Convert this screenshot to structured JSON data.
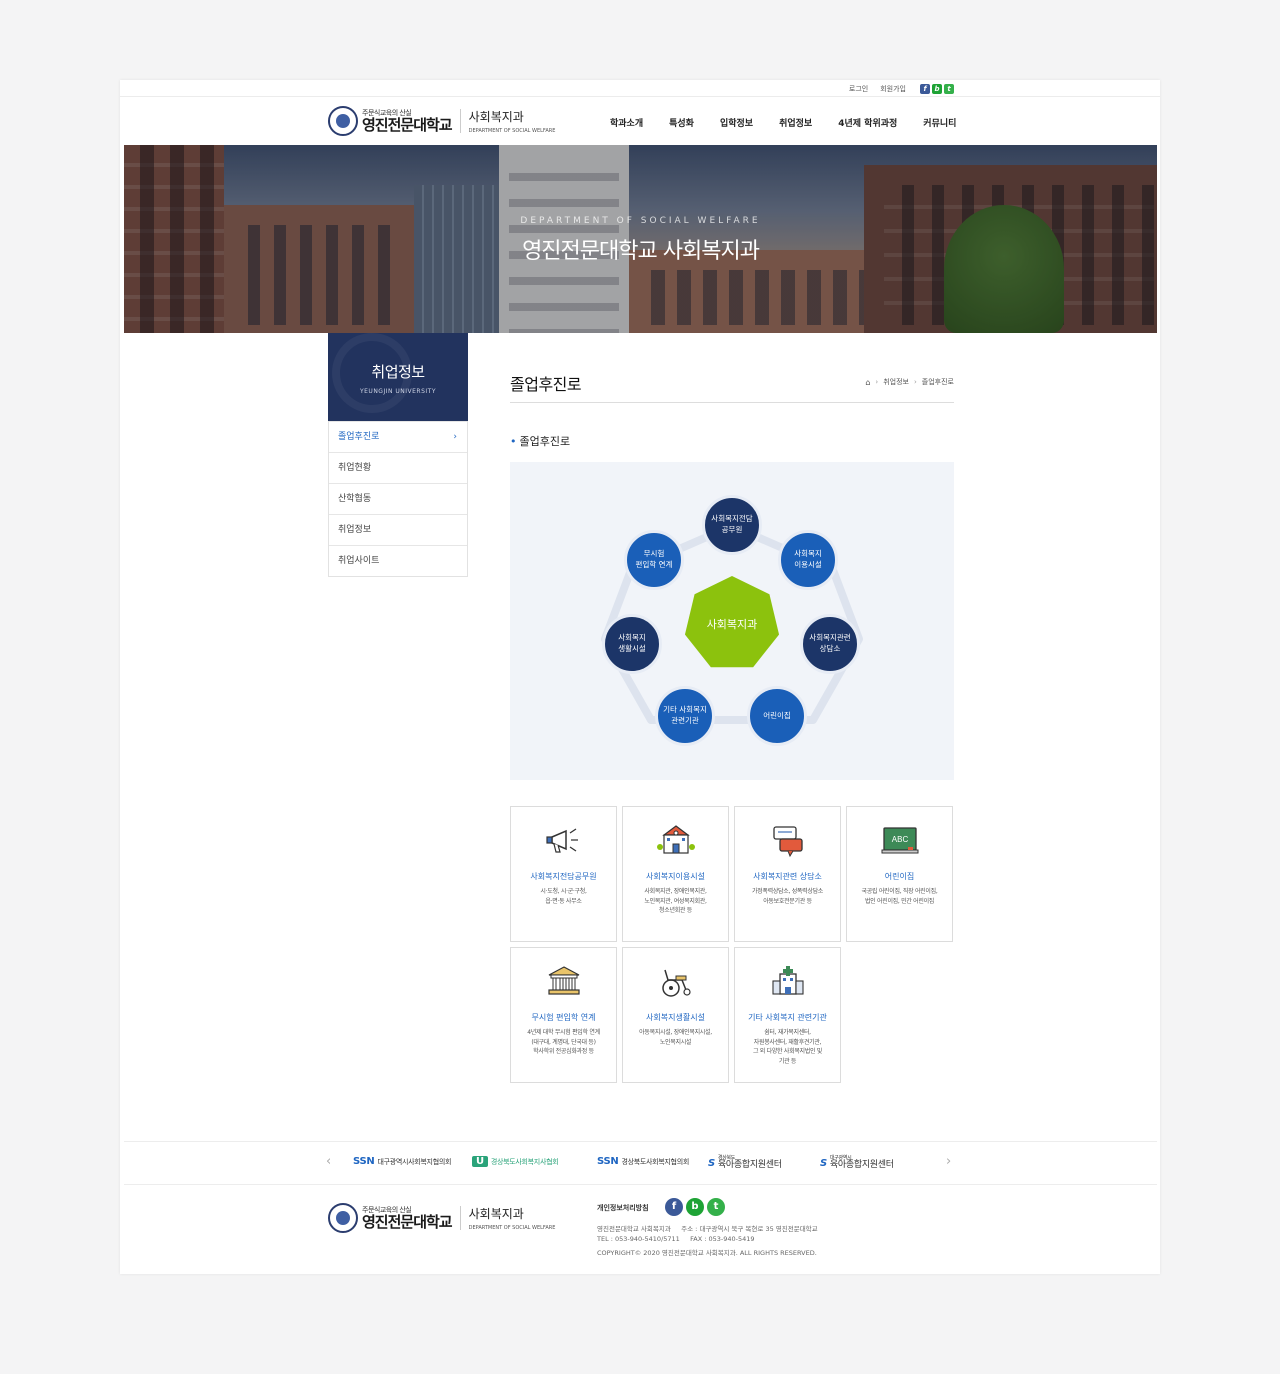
{
  "util": {
    "login": "로그인",
    "join": "회원가입",
    "sns": [
      "f",
      "b",
      "t"
    ]
  },
  "logo": {
    "slogan": "주문식교육의 산실",
    "school": "영진전문대학교",
    "dept_ko": "사회복지과",
    "dept_en": "DEPARTMENT OF SOCIAL WELFARE"
  },
  "gnb": [
    "학과소개",
    "특성화",
    "입학정보",
    "취업정보",
    "4년제 학위과정",
    "커뮤니티"
  ],
  "hero": {
    "en": "DEPARTMENT OF SOCIAL WELFARE",
    "ko": "영진전문대학교 사회복지과"
  },
  "lnb": {
    "title": "취업정보",
    "subtitle": "YEUNGJIN UNIVERSITY",
    "items": [
      "졸업후진로",
      "취업현황",
      "산학협동",
      "취업정보",
      "취업사이트"
    ]
  },
  "content": {
    "title": "졸업후진로",
    "breadcrumb": [
      "취업정보",
      "졸업후진로"
    ],
    "subtitle": "졸업후진로"
  },
  "diagram": {
    "center": "사회복지과",
    "nodes": [
      {
        "line1": "사회복지전담",
        "line2": "공무원"
      },
      {
        "line1": "사회복지",
        "line2": "이용시설"
      },
      {
        "line1": "사회복지관련",
        "line2": "상담소"
      },
      {
        "line1": "어린이집",
        "line2": ""
      },
      {
        "line1": "기타 사회복지",
        "line2": "관련기관"
      },
      {
        "line1": "사회복지",
        "line2": "생활시설"
      },
      {
        "line1": "무시험",
        "line2": "편입학 연계"
      }
    ]
  },
  "cards": [
    {
      "title": "사회복지전담공무원",
      "desc1": "시·도청, 시·군·구청,",
      "desc2": "읍·면·동 사무소",
      "desc3": "",
      "desc4": ""
    },
    {
      "title": "사회복지이용시설",
      "desc1": "사회복지관, 장애인복지관,",
      "desc2": "노인복지관, 여성복지회관,",
      "desc3": "청소년회관 등",
      "desc4": ""
    },
    {
      "title": "사회복지관련 상담소",
      "desc1": "가정폭력상담소, 성폭력상담소",
      "desc2": "아동보호전문기관 등",
      "desc3": "",
      "desc4": ""
    },
    {
      "title": "어린이집",
      "desc1": "국공립 어린이집, 직장 어린이집,",
      "desc2": "법인 어린이집, 민간 어린이집",
      "desc3": "",
      "desc4": ""
    },
    {
      "title": "무시험 편입학 연계",
      "desc1": "4년제 대학 무시험 편입학 연계",
      "desc2": "(대구대, 계명대, 단국대 등)",
      "desc3": "학사학위 전공심화과정 등",
      "desc4": ""
    },
    {
      "title": "사회복지생활시설",
      "desc1": "아동복지시설, 장애인복지시설,",
      "desc2": "노인복지시설",
      "desc3": "",
      "desc4": ""
    },
    {
      "title": "기타 사회복지 관련기관",
      "desc1": "쉼터, 재가복지센터,",
      "desc2": "자원봉사센터, 재활후견기관,",
      "desc3": "그 외 다양한 사회복지법인 및",
      "desc4": "기관 등"
    }
  ],
  "partners": [
    {
      "logo": "SSN",
      "name": "대구광역시사회복지협의회"
    },
    {
      "logo": "U",
      "name": "경상북도사회복지사협회"
    },
    {
      "logo": "SSN",
      "name": "경상북도사회복지협의회"
    },
    {
      "logo": "S",
      "region": "경상북도",
      "name": "육아종합지원센터"
    },
    {
      "logo": "S",
      "region": "대구광역시",
      "name": "육아종합지원센터"
    }
  ],
  "footer": {
    "privacy": "개인정보처리방침",
    "sns": [
      "f",
      "b",
      "t"
    ],
    "info1": "영진전문대학교 사회복지과     주소 : 대구광역시 북구 복현로 35 영진전문대학교",
    "info2": "TEL : 053-940-5410/5711     FAX : 053-940-5419",
    "copyright": "COPYRIGHT© 2020 영진전문대학교 사회복지과. ALL RIGHTS RESERVED."
  },
  "colors": {
    "navy": "#22335e",
    "blue": "#1f66c2",
    "green": "#8cc20d"
  }
}
